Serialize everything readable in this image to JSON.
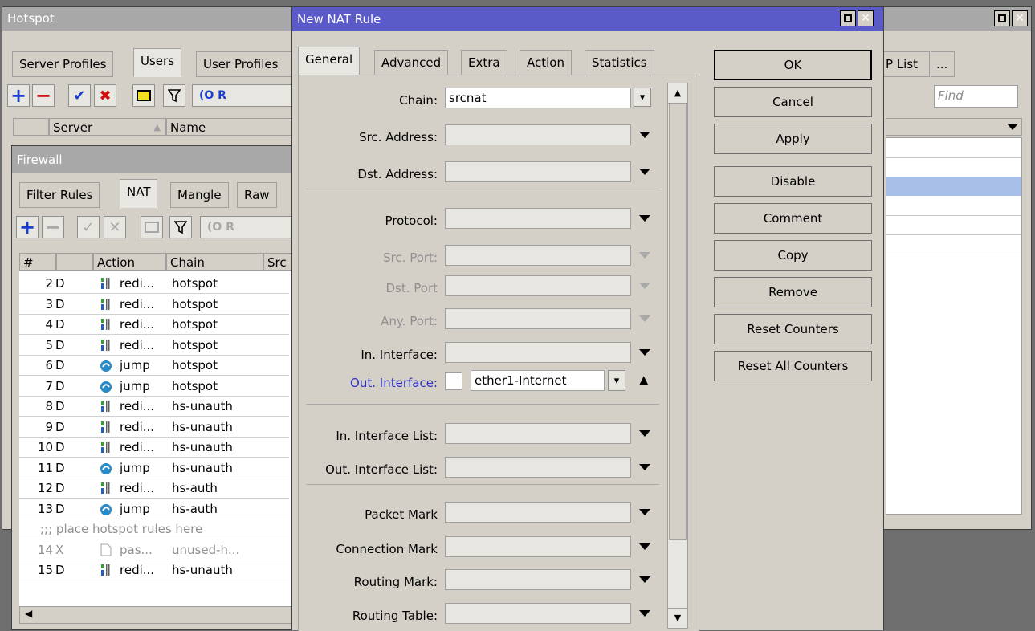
{
  "hotspot": {
    "title": "Hotspot",
    "tabs": [
      "Server Profiles",
      "Users",
      "User Profiles",
      "P List",
      "..."
    ],
    "find_placeholder": "Find",
    "columns": [
      "Server",
      "Name"
    ]
  },
  "firewall": {
    "title": "Firewall",
    "tabs": [
      "Filter Rules",
      "NAT",
      "Mangle",
      "Raw"
    ],
    "columns": [
      "#",
      "Action",
      "Chain",
      "Src"
    ],
    "rows": [
      {
        "num": "2",
        "flag": "D",
        "action": "redi...",
        "chain": "hotspot",
        "icon": "redirect-icon"
      },
      {
        "num": "3",
        "flag": "D",
        "action": "redi...",
        "chain": "hotspot",
        "icon": "redirect-icon"
      },
      {
        "num": "4",
        "flag": "D",
        "action": "redi...",
        "chain": "hotspot",
        "icon": "redirect-icon"
      },
      {
        "num": "5",
        "flag": "D",
        "action": "redi...",
        "chain": "hotspot",
        "icon": "redirect-icon"
      },
      {
        "num": "6",
        "flag": "D",
        "action": "jump",
        "chain": "hotspot",
        "icon": "jump-icon"
      },
      {
        "num": "7",
        "flag": "D",
        "action": "jump",
        "chain": "hotspot",
        "icon": "jump-icon"
      },
      {
        "num": "8",
        "flag": "D",
        "action": "redi...",
        "chain": "hs-unauth",
        "icon": "redirect-icon"
      },
      {
        "num": "9",
        "flag": "D",
        "action": "redi...",
        "chain": "hs-unauth",
        "icon": "redirect-icon"
      },
      {
        "num": "10",
        "flag": "D",
        "action": "redi...",
        "chain": "hs-unauth",
        "icon": "redirect-icon"
      },
      {
        "num": "11",
        "flag": "D",
        "action": "jump",
        "chain": "hs-unauth",
        "icon": "jump-icon"
      },
      {
        "num": "12",
        "flag": "D",
        "action": "redi...",
        "chain": "hs-auth",
        "icon": "redirect-icon"
      },
      {
        "num": "13",
        "flag": "D",
        "action": "jump",
        "chain": "hs-auth",
        "icon": "jump-icon"
      }
    ],
    "comment_row": ";;; place hotspot rules here",
    "disabled_row": {
      "num": "14",
      "flag": "X",
      "action": "pas...",
      "chain": "unused-h...",
      "icon": "passthrough-icon"
    },
    "last_row": {
      "num": "15",
      "flag": "D",
      "action": "redi...",
      "chain": "hs-unauth",
      "icon": "redirect-icon"
    }
  },
  "nat_dialog": {
    "title": "New NAT Rule",
    "tabs": [
      "General",
      "Advanced",
      "Extra",
      "Action",
      "Statistics"
    ],
    "fields": {
      "chain_label": "Chain:",
      "chain_value": "srcnat",
      "src_address_label": "Src. Address:",
      "dst_address_label": "Dst. Address:",
      "protocol_label": "Protocol:",
      "src_port_label": "Src. Port:",
      "dst_port_label": "Dst. Port",
      "any_port_label": "Any. Port:",
      "in_interface_label": "In. Interface:",
      "out_interface_label": "Out. Interface:",
      "out_interface_value": "ether1-Internet",
      "in_interface_list_label": "In. Interface List:",
      "out_interface_list_label": "Out. Interface List:",
      "packet_mark_label": "Packet Mark",
      "connection_mark_label": "Connection Mark",
      "routing_mark_label": "Routing Mark:",
      "routing_table_label": "Routing Table:"
    },
    "buttons": [
      "OK",
      "Cancel",
      "Apply",
      "Disable",
      "Comment",
      "Copy",
      "Remove",
      "Reset Counters",
      "Reset All Counters"
    ],
    "label_accent": "#3030c0"
  }
}
